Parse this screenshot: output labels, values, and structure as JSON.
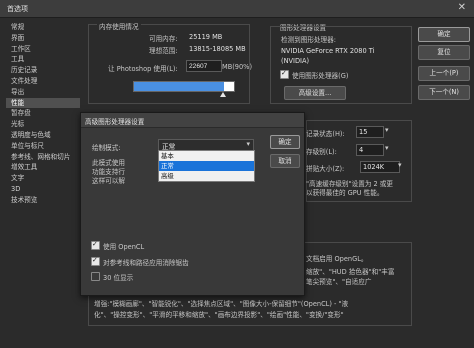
{
  "window": {
    "title": "首选项",
    "close_glyph": "✕"
  },
  "sidebar": {
    "items": [
      "常规",
      "界面",
      "工作区",
      "工具",
      "历史记录",
      "文件处理",
      "导出",
      "性能",
      "暂存盘",
      "光标",
      "透明度与色域",
      "单位与标尺",
      "参考线、网格和切片",
      "增效工具",
      "文字",
      "3D",
      "技术预览"
    ],
    "selected_index": 7
  },
  "buttons": {
    "ok": "确定",
    "reset": "复位",
    "prev": "上一个(P)",
    "next": "下一个(N)"
  },
  "memory": {
    "section_title": "内存使用情况",
    "available_label": "可用内存:",
    "available_value": "25119 MB",
    "ideal_label": "理想范围:",
    "ideal_value": "13815-18085 MB",
    "let_use_label": "让 Photoshop 使用(L):",
    "let_use_value": "22607",
    "let_use_unit": "MB(90%)",
    "slider_fraction": 0.9
  },
  "gpu": {
    "section_title": "图形处理器设置",
    "detected_label": "检测到图形处理器:",
    "gpu_name_line1": "NVIDIA GeForce RTX 2080 Ti",
    "gpu_name_line2": "(NVIDIA)",
    "use_gpu_label": "使用图形处理器(G)",
    "advanced_button": "高级设置..."
  },
  "history_cache": {
    "history_label": "记录状态(H):",
    "history_value": "15",
    "cache_levels_label": "存级别(L):",
    "cache_levels_value": "4",
    "tile_size_label": "拼贴大小(Z):",
    "tile_size_value": "1024K",
    "note_line1": "\"高速缓存级别\"设置为 2 或更",
    "note_line2": "以获得最佳的 GPU 性能。"
  },
  "description": {
    "right_line1": "文档启用 OpenGL。",
    "right_line2": "缩放\"、\"HUD 拾色器\"和\"丰富",
    "right_line3": "笔尖预览\"、\"自适应广",
    "bottom_line1": "增强:\"模糊画廊\"、\"智能锐化\"、\"选择焦点区域\"、\"图像大小-保留细节\"(OpenCL) - \"液",
    "bottom_line2": "化\"、\"操控变形\"、\"平滑的平移和缩放\"、\"画布边界投影\"、\"绘画\"性能、\"变换/\"变形\""
  },
  "dialog": {
    "title": "高级图形处理器设置",
    "mode_label": "绘制模式:",
    "mode_value": "正常",
    "mode_options": [
      "基本",
      "正常",
      "高级"
    ],
    "mode_highlight_index": 1,
    "hidden_text_line1": "此模式使用",
    "hidden_text_line2": "功能支持行",
    "hidden_text_line3": "这样可以解",
    "ok": "确定",
    "cancel": "取消",
    "opencl_label": "使用 OpenCL",
    "antialias_label": "对参考线和路径应用消除锯齿",
    "bit30_label": "30 位显示",
    "opencl_checked": true,
    "antialias_checked": true,
    "bit30_checked": false
  }
}
